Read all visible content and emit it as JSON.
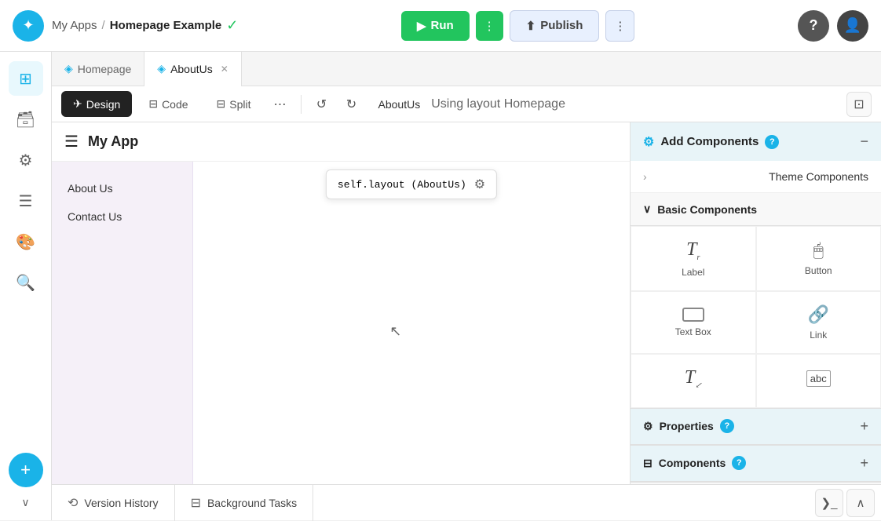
{
  "header": {
    "logo_symbol": "✦",
    "breadcrumb": {
      "myapps": "My Apps",
      "separator": "/",
      "app_name": "Homepage Example"
    },
    "status_check": "✓",
    "run_label": "Run",
    "run_icon": "▶",
    "more_icon": "⋮",
    "publish_label": "Publish",
    "publish_icon": "⬆",
    "help_icon": "?",
    "avatar_icon": "👤"
  },
  "sidebar_icons": {
    "grid_icon": "⊞",
    "db_icon": "🗃",
    "settings_icon": "⚙",
    "list_icon": "☰",
    "paint_icon": "🎨",
    "search_icon": "🔍",
    "add_icon": "+",
    "chevron_icon": "∨"
  },
  "tabs": [
    {
      "id": "homepage",
      "label": "Homepage",
      "icon": "◈",
      "active": false,
      "closable": false
    },
    {
      "id": "aboutus",
      "label": "AboutUs",
      "icon": "◈",
      "active": true,
      "closable": true
    }
  ],
  "toolbar": {
    "design_label": "Design",
    "design_icon": "✈",
    "code_label": "Code",
    "code_icon": "⊟",
    "split_label": "Split",
    "split_icon": "⊟",
    "more_icon": "⋯",
    "undo_icon": "↺",
    "redo_icon": "↻",
    "path_name": "AboutUs",
    "path_detail": "Using layout Homepage",
    "layout_icon": "⊡"
  },
  "canvas": {
    "navbar_icon": "☰",
    "app_title": "My App",
    "layout_tooltip": "self.layout (AboutUs)",
    "settings_icon": "⚙",
    "sidebar_items": [
      {
        "label": "About Us"
      },
      {
        "label": "Contact Us"
      }
    ],
    "cursor_symbol": "↖"
  },
  "right_panel": {
    "add_components": {
      "title": "Add Components",
      "help_badge": "?",
      "collapse_icon": "−"
    },
    "theme_components": {
      "title": "Theme Components",
      "expand_icon": "›"
    },
    "basic_components": {
      "title": "Basic Components",
      "collapse_icon": "∨"
    },
    "components_grid": [
      {
        "id": "label",
        "label": "Label",
        "icon": "T↗"
      },
      {
        "id": "button",
        "label": "Button",
        "icon": "🖱"
      },
      {
        "id": "textbox",
        "label": "Text Box",
        "icon": "⊟"
      },
      {
        "id": "link",
        "label": "Link",
        "icon": "🔗"
      },
      {
        "id": "more1",
        "label": "",
        "icon": "T↙"
      },
      {
        "id": "more2",
        "label": "",
        "icon": "abc"
      }
    ],
    "properties": {
      "title": "Properties",
      "help_badge": "?",
      "plus_icon": "+"
    },
    "components_section": {
      "title": "Components",
      "help_badge": "?",
      "plus_icon": "+"
    }
  },
  "bottom_bar": {
    "version_history_label": "Version History",
    "version_history_icon": "⟲",
    "background_tasks_label": "Background Tasks",
    "background_tasks_icon": "⊟",
    "terminal_icon": "❯_",
    "chevron_up_icon": "∧"
  }
}
